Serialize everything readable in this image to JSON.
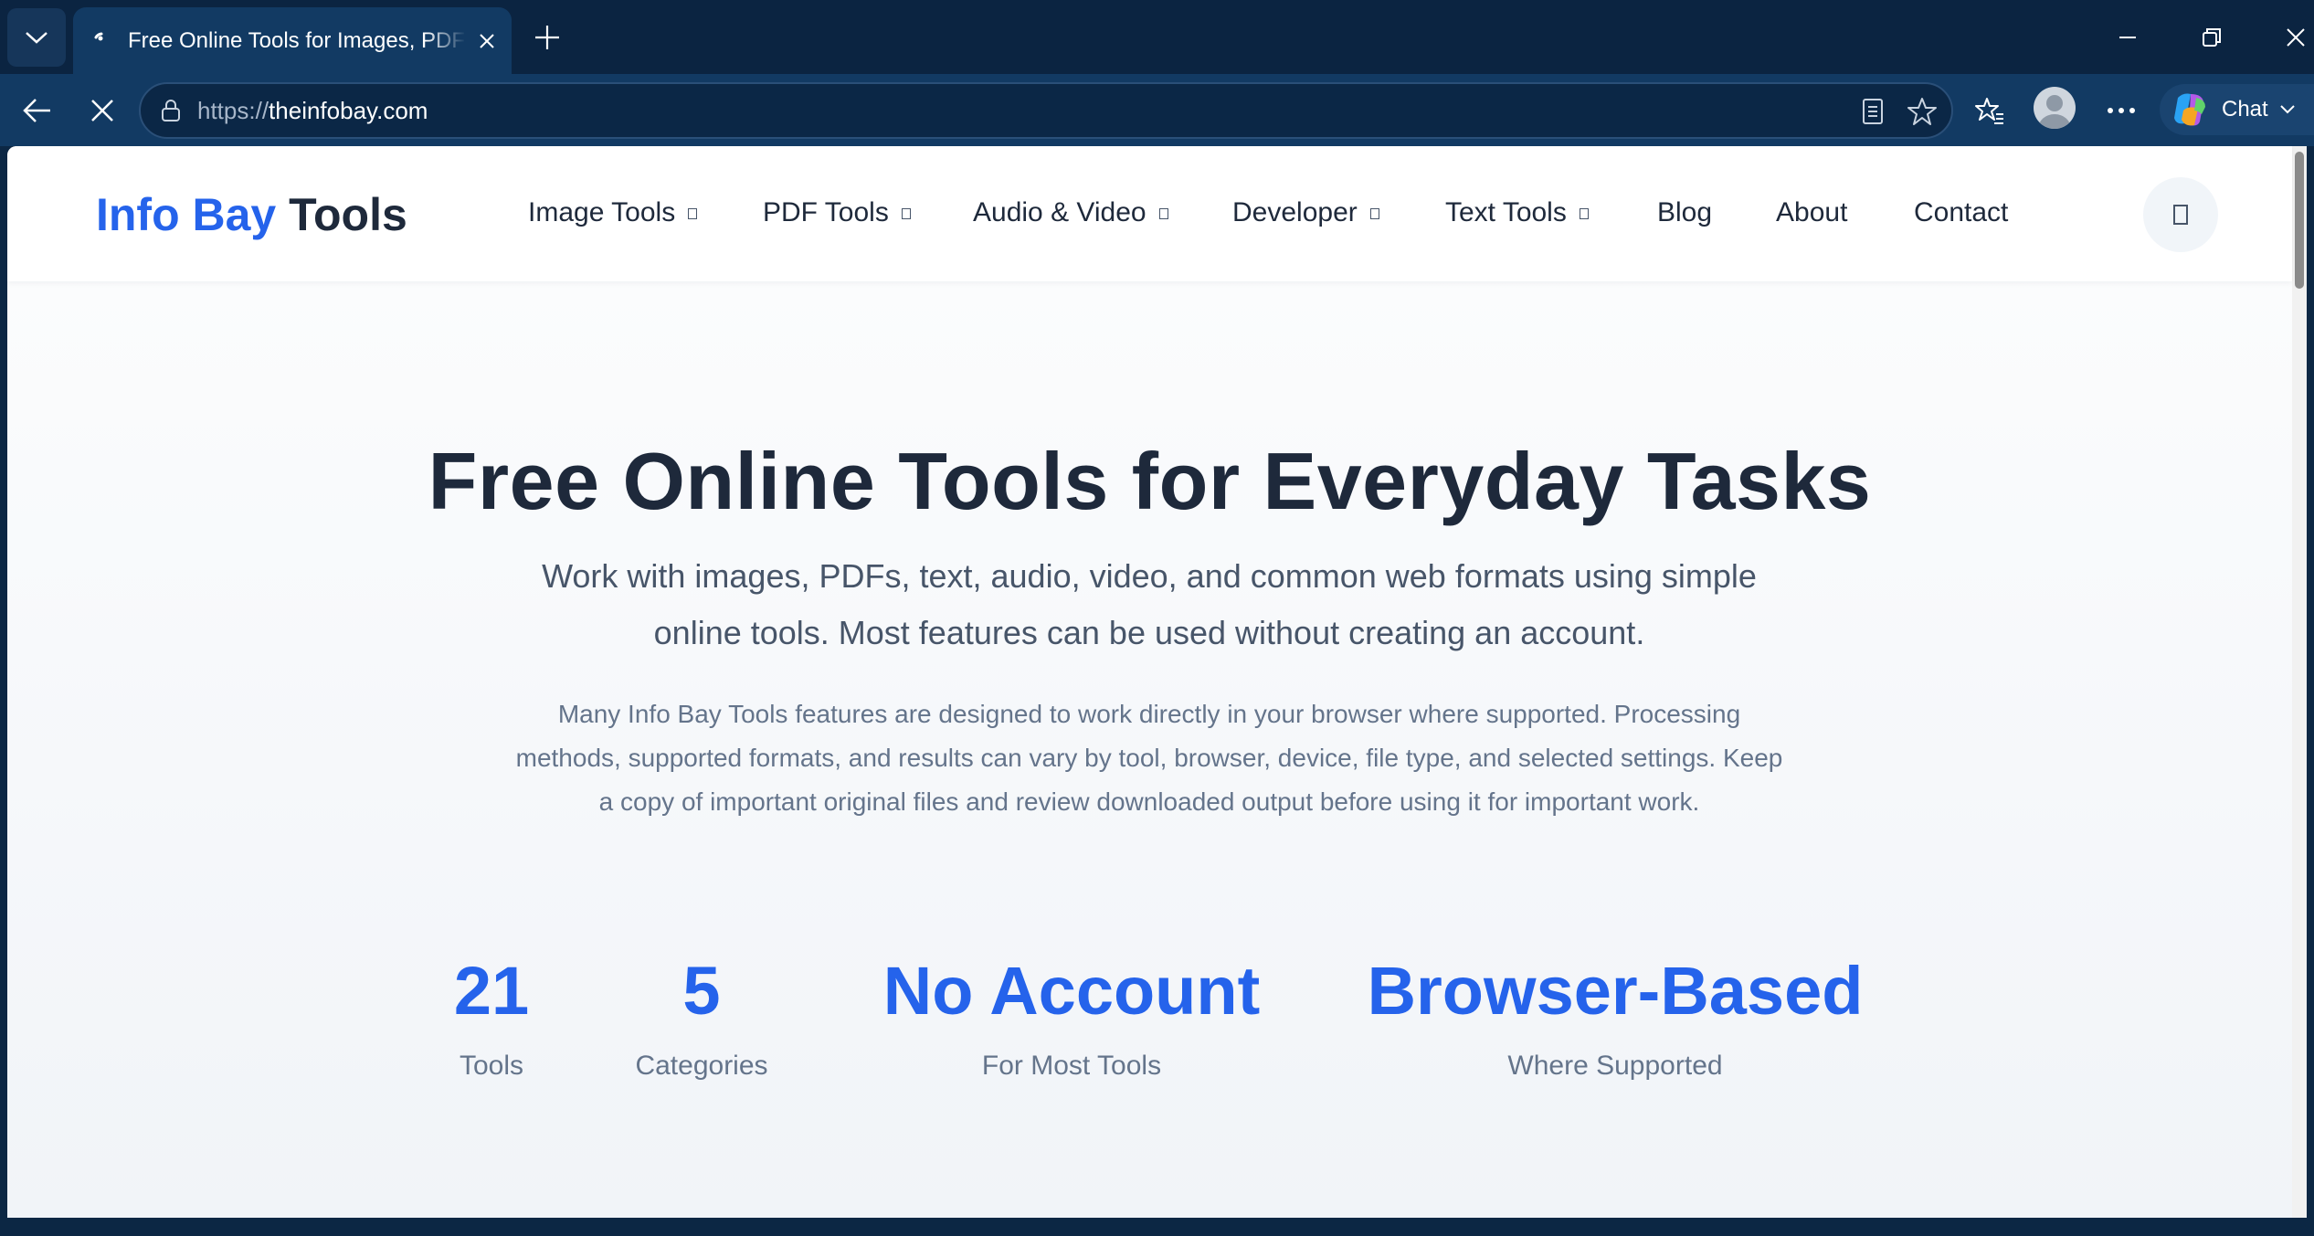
{
  "browser": {
    "tab": {
      "title": "Free Online Tools for Images, PDFs"
    },
    "address": {
      "scheme": "https://",
      "host": "theinfobay.com"
    },
    "chat_label": "Chat",
    "icons": {
      "tab_menu": "chevron-down-icon",
      "new_tab": "plus-icon",
      "back": "back-arrow-icon",
      "stop": "stop-icon",
      "lock": "lock-icon",
      "reader": "reader-mode-icon",
      "favorite": "star-icon",
      "favorites": "favorites-icon",
      "profile": "avatar",
      "more": "more-icon"
    }
  },
  "site": {
    "logo": {
      "part1": "Info Bay",
      "part2": "Tools"
    },
    "nav": [
      {
        "label": "Image Tools",
        "has_menu": true
      },
      {
        "label": "PDF Tools",
        "has_menu": true
      },
      {
        "label": "Audio & Video",
        "has_menu": true
      },
      {
        "label": "Developer",
        "has_menu": true
      },
      {
        "label": "Text Tools",
        "has_menu": true
      },
      {
        "label": "Blog",
        "has_menu": false
      },
      {
        "label": "About",
        "has_menu": false
      },
      {
        "label": "Contact",
        "has_menu": false
      }
    ]
  },
  "hero": {
    "title": "Free Online Tools for Everyday Tasks",
    "subtitle": "Work with images, PDFs, text, audio, video, and common web formats using simple online tools. Most features can be used without creating an account.",
    "note": "Many Info Bay Tools features are designed to work directly in your browser where supported. Processing methods, supported formats, and results can vary by tool, browser, device, file type, and selected settings. Keep a copy of important original files and review downloaded output before using it for important work.",
    "stats": [
      {
        "value": "21",
        "label": "Tools"
      },
      {
        "value": "5",
        "label": "Categories"
      },
      {
        "value": "No Account",
        "label": "For Most Tools"
      },
      {
        "value": "Browser-Based",
        "label": "Where Supported"
      }
    ]
  },
  "colors": {
    "accent": "#2563eb",
    "heading": "#1e293b",
    "body_text": "#475569",
    "muted_text": "#64748b",
    "browser_chrome": "#0b2441"
  }
}
